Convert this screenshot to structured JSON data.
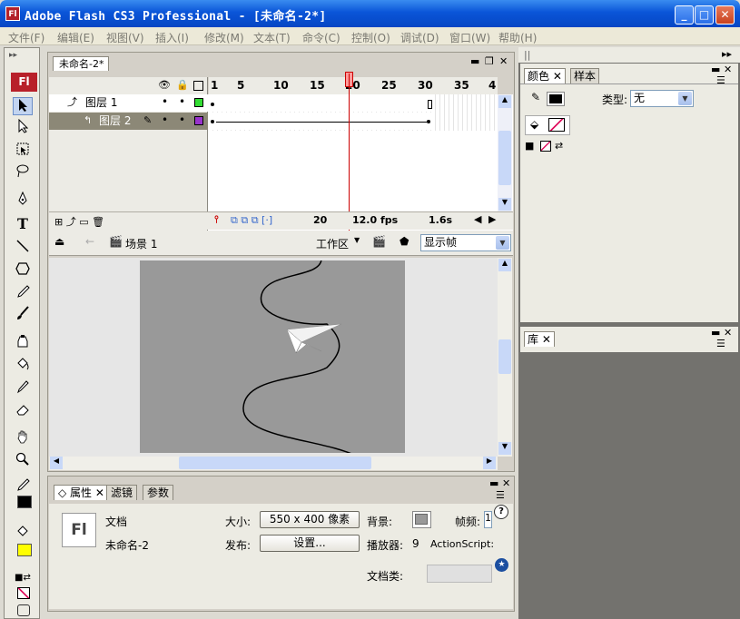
{
  "window": {
    "title": "Adobe Flash CS3 Professional - [未命名-2*]",
    "app_logo": "Fl",
    "minimize": "_",
    "maximize": "□",
    "close": "✕"
  },
  "menu": [
    "文件(F)",
    "编辑(E)",
    "视图(V)",
    "插入(I)",
    "修改(M)",
    "文本(T)",
    "命令(C)",
    "控制(O)",
    "调试(D)",
    "窗口(W)",
    "帮助(H)"
  ],
  "toolbox": {
    "logo": "Fl",
    "tools": [
      "selection-icon",
      "subselection-icon",
      "free-transform-icon",
      "lasso-icon",
      "pen-icon",
      "text-icon",
      "line-icon",
      "polystar-icon",
      "pencil-icon",
      "brush-icon",
      "ink-bottle-icon",
      "paint-bucket-icon",
      "eyedropper-icon",
      "eraser-icon",
      "hand-icon",
      "zoom-icon"
    ],
    "text_tool": "T",
    "stroke_color": "#000000",
    "fill_color": "#ffff00"
  },
  "document": {
    "tab": "未命名-2*"
  },
  "timeline": {
    "ruler": [
      "1",
      "5",
      "10",
      "15",
      "20",
      "25",
      "30",
      "35",
      "4"
    ],
    "current_frame_marker": 20,
    "layers": [
      {
        "name": "图层 1",
        "color": "#33dd33",
        "selected": false
      },
      {
        "name": "图层 2",
        "color": "#9933cc",
        "selected": true
      }
    ],
    "status": {
      "frame": "20",
      "fps": "12.0 fps",
      "time": "1.6s"
    }
  },
  "scene": {
    "name": "场景 1",
    "workspace": "工作区",
    "zoom": "显示帧"
  },
  "properties": {
    "tabs": [
      "属性",
      "滤镜",
      "参数"
    ],
    "doc_label": "文档",
    "doc_name": "未命名-2",
    "size_label": "大小:",
    "size_value": "550 x 400 像素",
    "publish_label": "发布:",
    "settings_button": "设置...",
    "bg_label": "背景:",
    "fps_label": "帧频:",
    "fps_value": "1",
    "player_label": "播放器:",
    "player_value": "9",
    "actionscript_label": "ActionScript:",
    "doc_class_label": "文档类:"
  },
  "color_panel": {
    "tabs": [
      "颜色",
      "样本"
    ],
    "type_label": "类型:",
    "type_value": "无"
  },
  "library_panel": {
    "tabs": [
      "库"
    ]
  }
}
